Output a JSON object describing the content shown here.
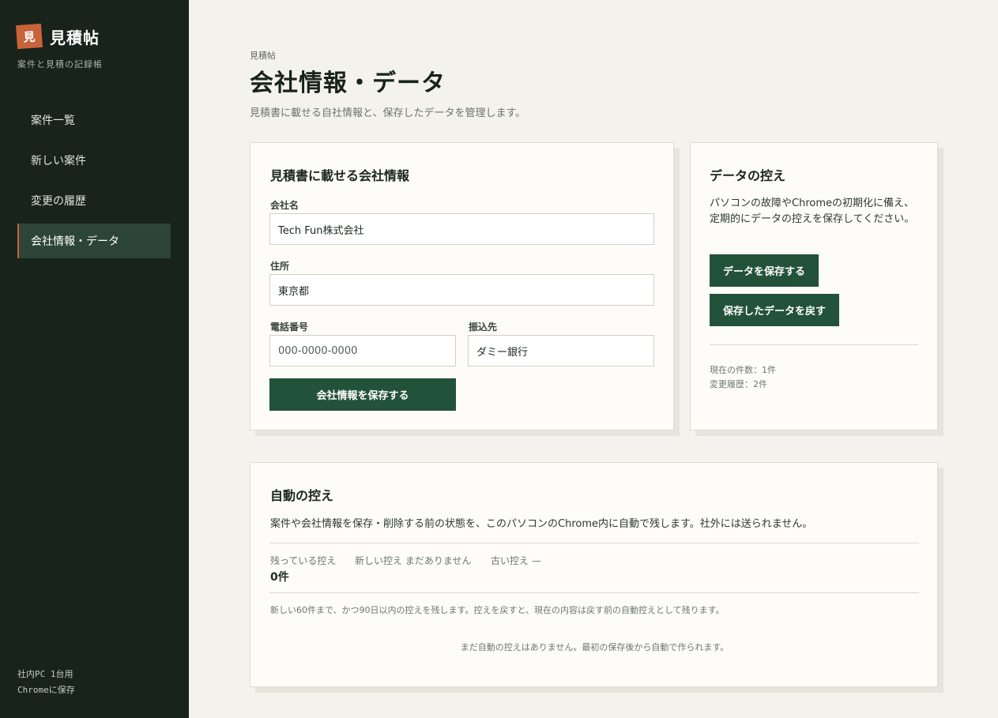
{
  "brand": {
    "mark": "見",
    "name": "見積帖",
    "subtitle": "案件と見積の記録帳"
  },
  "nav": {
    "items": [
      {
        "label": "案件一覧"
      },
      {
        "label": "新しい案件"
      },
      {
        "label": "変更の履歴"
      },
      {
        "label": "会社情報・データ"
      }
    ],
    "active_index": 3
  },
  "sidebar_footer": {
    "line1": "社内PC 1台用",
    "line2": "Chromeに保存"
  },
  "header": {
    "breadcrumb": "見積帖",
    "title": "会社情報・データ",
    "description": "見積書に載せる自社情報と、保存したデータを管理します。"
  },
  "company": {
    "title": "見積書に載せる会社情報",
    "name_label": "会社名",
    "name_value": "Tech Fun株式会社",
    "address_label": "住所",
    "address_value": "東京都",
    "phone_label": "電話番号",
    "phone_placeholder": "000-0000-0000",
    "bank_label": "振込先",
    "bank_value": "ダミー銀行",
    "save_label": "会社情報を保存する"
  },
  "backup": {
    "title": "データの控え",
    "description": "パソコンの故障やChromeの初期化に備え、定期的にデータの控えを保存してください。",
    "save_label": "データを保存する",
    "restore_label": "保存したデータを戻す",
    "count_text": "現在の件数：1件",
    "history_text": "変更履歴：2件"
  },
  "auto": {
    "title": "自動の控え",
    "description": "案件や会社情報を保存・削除する前の状態を、このパソコンのChrome内に自動で残します。社外には送られません。",
    "remaining_label": "残っている控え",
    "remaining_value": "0件",
    "newest_label": "新しい控え",
    "newest_value": "まだありません",
    "oldest_label": "古い控え",
    "oldest_value": "—",
    "policy_text": "新しい60件まで、かつ90日以内の控えを残します。控えを戻すと、現在の内容は戻す前の自動控えとして残ります。",
    "empty_text": "まだ自動の控えはありません。最初の保存後から自動で作られます。"
  },
  "colors": {
    "sidebar_bg": "#17231b",
    "accent": "#c8623a",
    "button": "#23523a",
    "page_bg": "#f4f2ec"
  }
}
